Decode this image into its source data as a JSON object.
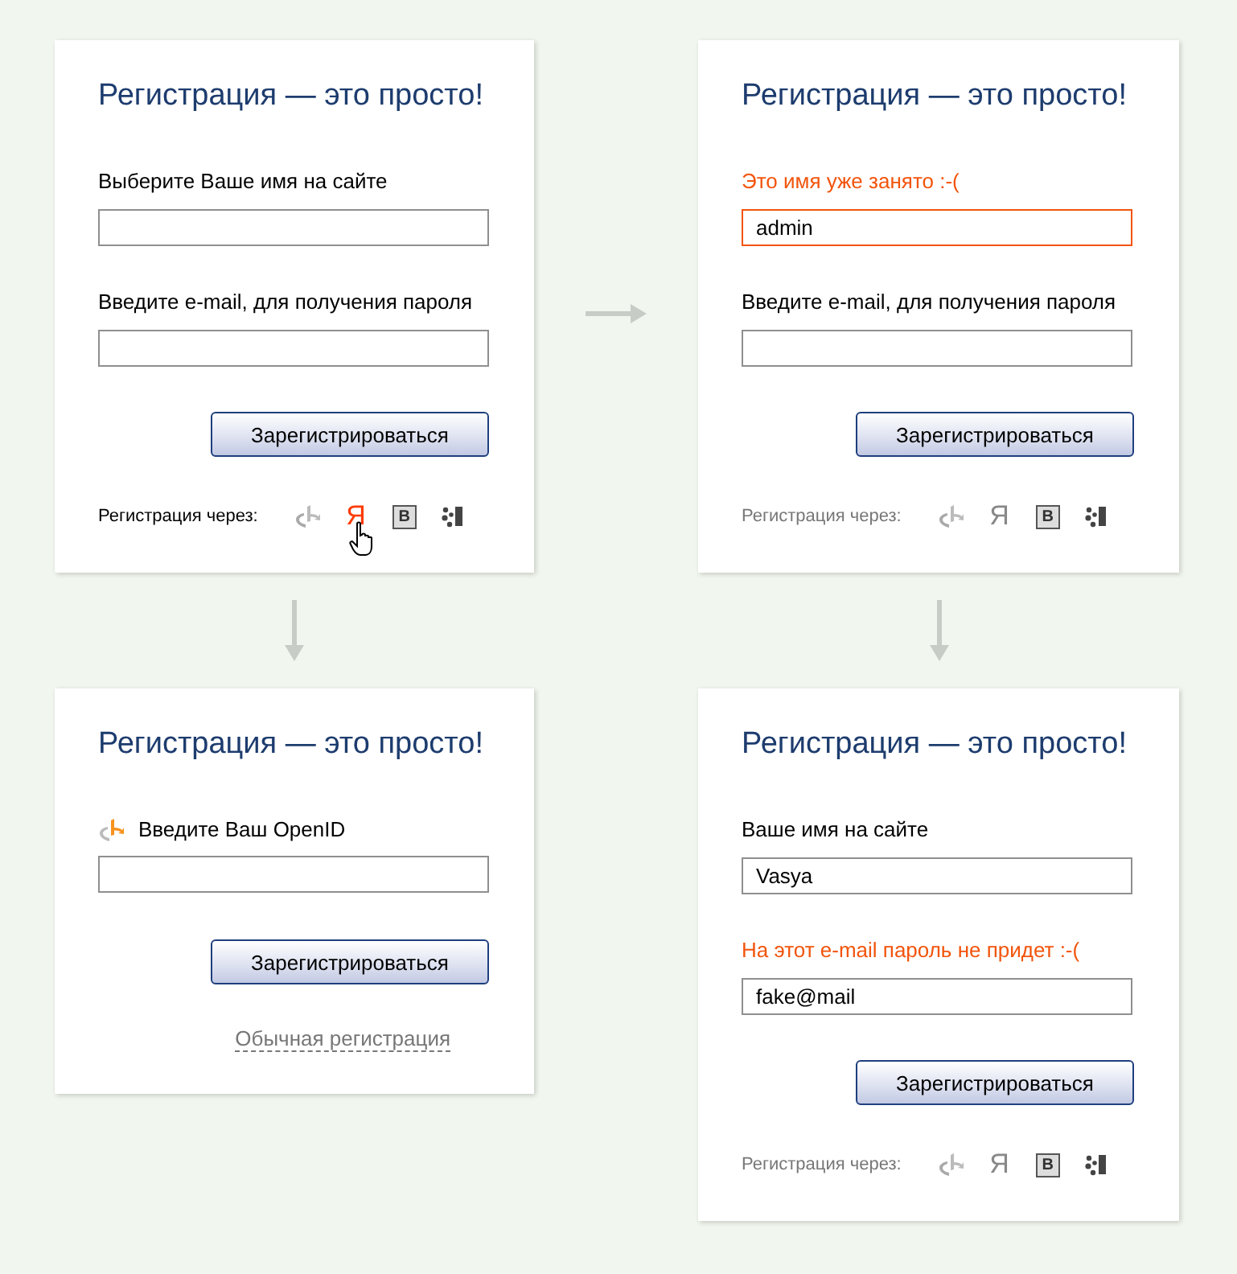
{
  "cards": [
    {
      "title": "Регистрация — это просто!",
      "fields": [
        {
          "kind": "text",
          "label": "Выберите Ваше имя на сайте",
          "label_error": false,
          "input_error": false
        },
        {
          "kind": "text",
          "label": "Введите e-mail, для получения пароля",
          "label_error": false,
          "input_error": false
        }
      ],
      "button": "Зарегистрироваться",
      "social": {
        "label": "Регистрация через:",
        "active": true,
        "providers": [
          {
            "kind": "openid",
            "hovered": false
          },
          {
            "kind": "yandex",
            "glyph": "Я",
            "hovered": true
          },
          {
            "kind": "vk",
            "glyph": "B",
            "hovered": false
          },
          {
            "kind": "moikrug",
            "hovered": false
          }
        ]
      }
    },
    {
      "title": "Регистрация — это просто!",
      "fields": [
        {
          "kind": "text",
          "label": "Это имя уже занято :-(",
          "value": "admin",
          "label_error": true,
          "input_error": true
        },
        {
          "kind": "text",
          "label": "Введите e-mail, для получения пароля",
          "label_error": false,
          "input_error": false
        }
      ],
      "button": "Зарегистрироваться",
      "social": {
        "label": "Регистрация через:",
        "active": false,
        "providers": [
          {
            "kind": "openid",
            "hovered": false
          },
          {
            "kind": "yandex",
            "glyph": "Я",
            "hovered": false
          },
          {
            "kind": "vk",
            "glyph": "B",
            "hovered": false
          },
          {
            "kind": "moikrug",
            "hovered": false
          }
        ]
      }
    },
    {
      "title": "Регистрация — это просто!",
      "fields": [
        {
          "kind": "openid",
          "label": "Введите Ваш OpenID",
          "label_error": false,
          "input_error": false
        }
      ],
      "button": "Зарегистрироваться",
      "link": "Обычная регистрация"
    },
    {
      "title": "Регистрация — это просто!",
      "fields": [
        {
          "kind": "text",
          "label": "Ваше имя на сайте",
          "value": "Vasya",
          "label_error": false,
          "input_error": false
        },
        {
          "kind": "text",
          "label": "На этот e-mail пароль не придет :-(",
          "value": "fake@mail",
          "label_error": true,
          "input_error": false
        }
      ],
      "button": "Зарегистрироваться",
      "social": {
        "label": "Регистрация через:",
        "active": false,
        "providers": [
          {
            "kind": "openid",
            "hovered": false
          },
          {
            "kind": "yandex",
            "glyph": "Я",
            "hovered": false
          },
          {
            "kind": "vk",
            "glyph": "B",
            "hovered": false
          },
          {
            "kind": "moikrug",
            "hovered": false
          }
        ]
      }
    }
  ]
}
